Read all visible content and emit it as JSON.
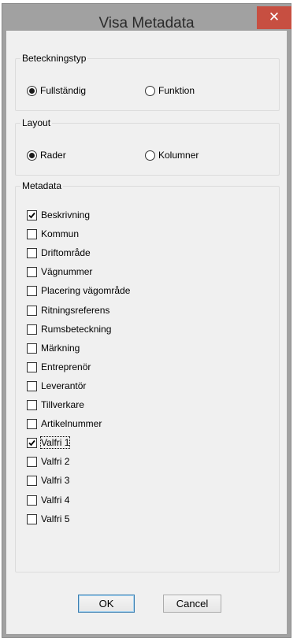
{
  "window": {
    "title": "Visa Metadata",
    "close_symbol": "✕"
  },
  "beteckningstyp": {
    "legend": "Beteckningstyp",
    "options": [
      {
        "label": "Fullständig",
        "selected": true
      },
      {
        "label": "Funktion",
        "selected": false
      }
    ]
  },
  "layout": {
    "legend": "Layout",
    "options": [
      {
        "label": "Rader",
        "selected": true
      },
      {
        "label": "Kolumner",
        "selected": false
      }
    ]
  },
  "metadata": {
    "legend": "Metadata",
    "items": [
      {
        "label": "Beskrivning",
        "checked": true
      },
      {
        "label": "Kommun",
        "checked": false
      },
      {
        "label": "Driftområde",
        "checked": false
      },
      {
        "label": "Vägnummer",
        "checked": false
      },
      {
        "label": "Placering vägområde",
        "checked": false
      },
      {
        "label": "Ritningsreferens",
        "checked": false
      },
      {
        "label": "Rumsbeteckning",
        "checked": false
      },
      {
        "label": "Märkning",
        "checked": false
      },
      {
        "label": "Entreprenör",
        "checked": false
      },
      {
        "label": "Leverantör",
        "checked": false
      },
      {
        "label": "Tillverkare",
        "checked": false
      },
      {
        "label": "Artikelnummer",
        "checked": false
      },
      {
        "label": "Valfri 1",
        "checked": true,
        "focused": true
      },
      {
        "label": "Valfri 2",
        "checked": false
      },
      {
        "label": "Valfri 3",
        "checked": false
      },
      {
        "label": "Valfri 4",
        "checked": false
      },
      {
        "label": "Valfri 5",
        "checked": false
      }
    ]
  },
  "buttons": {
    "ok_label": "OK",
    "cancel_label": "Cancel"
  },
  "colors": {
    "titlebar": "#a1a1a1",
    "close": "#c74f41",
    "dialog_bg": "#f0f0f0"
  }
}
